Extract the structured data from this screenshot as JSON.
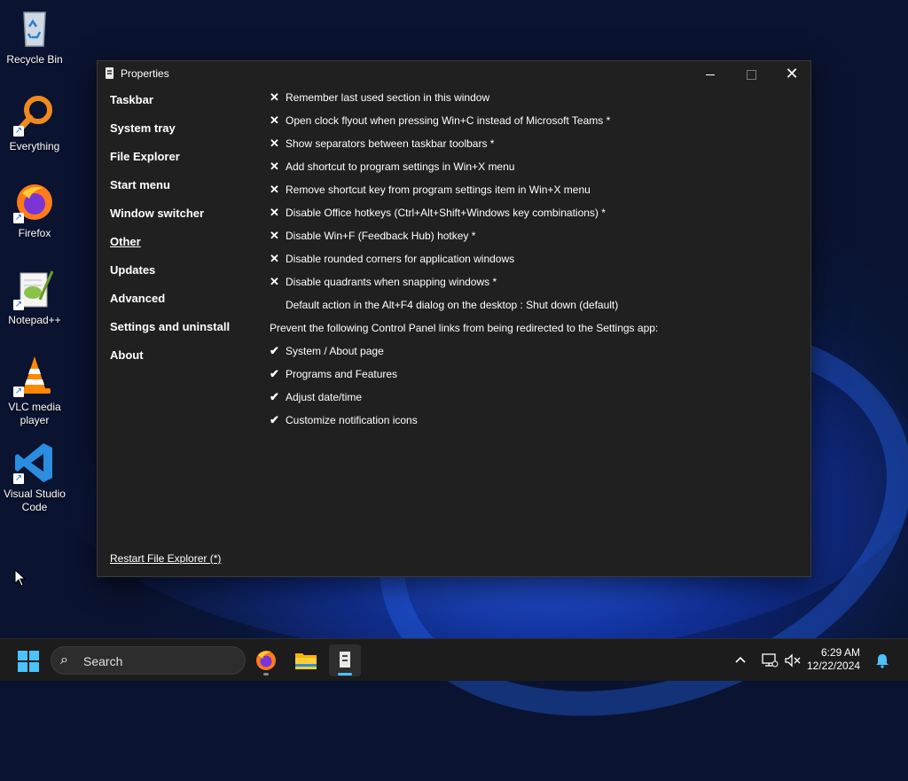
{
  "desktop": {
    "icons": [
      {
        "label": "Recycle Bin"
      },
      {
        "label": "Everything"
      },
      {
        "label": "Firefox"
      },
      {
        "label": "Notepad++"
      },
      {
        "label": "VLC media player"
      },
      {
        "label": "Visual Studio Code"
      }
    ]
  },
  "window": {
    "title": "Properties",
    "nav": [
      {
        "label": "Taskbar"
      },
      {
        "label": "System tray"
      },
      {
        "label": "File Explorer"
      },
      {
        "label": "Start menu"
      },
      {
        "label": "Window switcher"
      },
      {
        "label": "Other",
        "selected": true
      },
      {
        "label": "Updates"
      },
      {
        "label": "Advanced"
      },
      {
        "label": "Settings and uninstall"
      },
      {
        "label": "About"
      }
    ],
    "options": [
      {
        "mark": "✕",
        "text": "Remember last used section in this window"
      },
      {
        "mark": "✕",
        "text": "Open clock flyout when pressing Win+C instead of Microsoft Teams *"
      },
      {
        "mark": "✕",
        "text": "Show separators between taskbar toolbars *"
      },
      {
        "mark": "✕",
        "text": "Add shortcut to program settings in Win+X menu"
      },
      {
        "mark": "✕",
        "text": "Remove shortcut key from program settings item in Win+X menu"
      },
      {
        "mark": "✕",
        "text": "Disable Office hotkeys (Ctrl+Alt+Shift+Windows key combinations) *"
      },
      {
        "mark": "✕",
        "text": "Disable Win+F (Feedback Hub) hotkey *"
      },
      {
        "mark": "✕",
        "text": "Disable rounded corners for application windows"
      },
      {
        "mark": "✕",
        "text": "Disable quadrants when snapping windows *"
      },
      {
        "mark": "",
        "text": "Default action in the Alt+F4 dialog on the desktop : Shut down (default)"
      }
    ],
    "section_heading": "Prevent the following Control Panel links from being redirected to the Settings app:",
    "redirect_options": [
      {
        "mark": "✔",
        "text": "System / About page"
      },
      {
        "mark": "✔",
        "text": "Programs and Features"
      },
      {
        "mark": "✔",
        "text": "Adjust date/time"
      },
      {
        "mark": "✔",
        "text": "Customize notification icons"
      }
    ],
    "restart_link": "Restart File Explorer (*)"
  },
  "taskbar": {
    "search_placeholder": "Search",
    "time": "6:29 AM",
    "date": "12/22/2024"
  },
  "colors": {
    "window_bg": "#202020",
    "taskbar_bg": "#1c1c1c",
    "accent": "#4cc2ff"
  }
}
